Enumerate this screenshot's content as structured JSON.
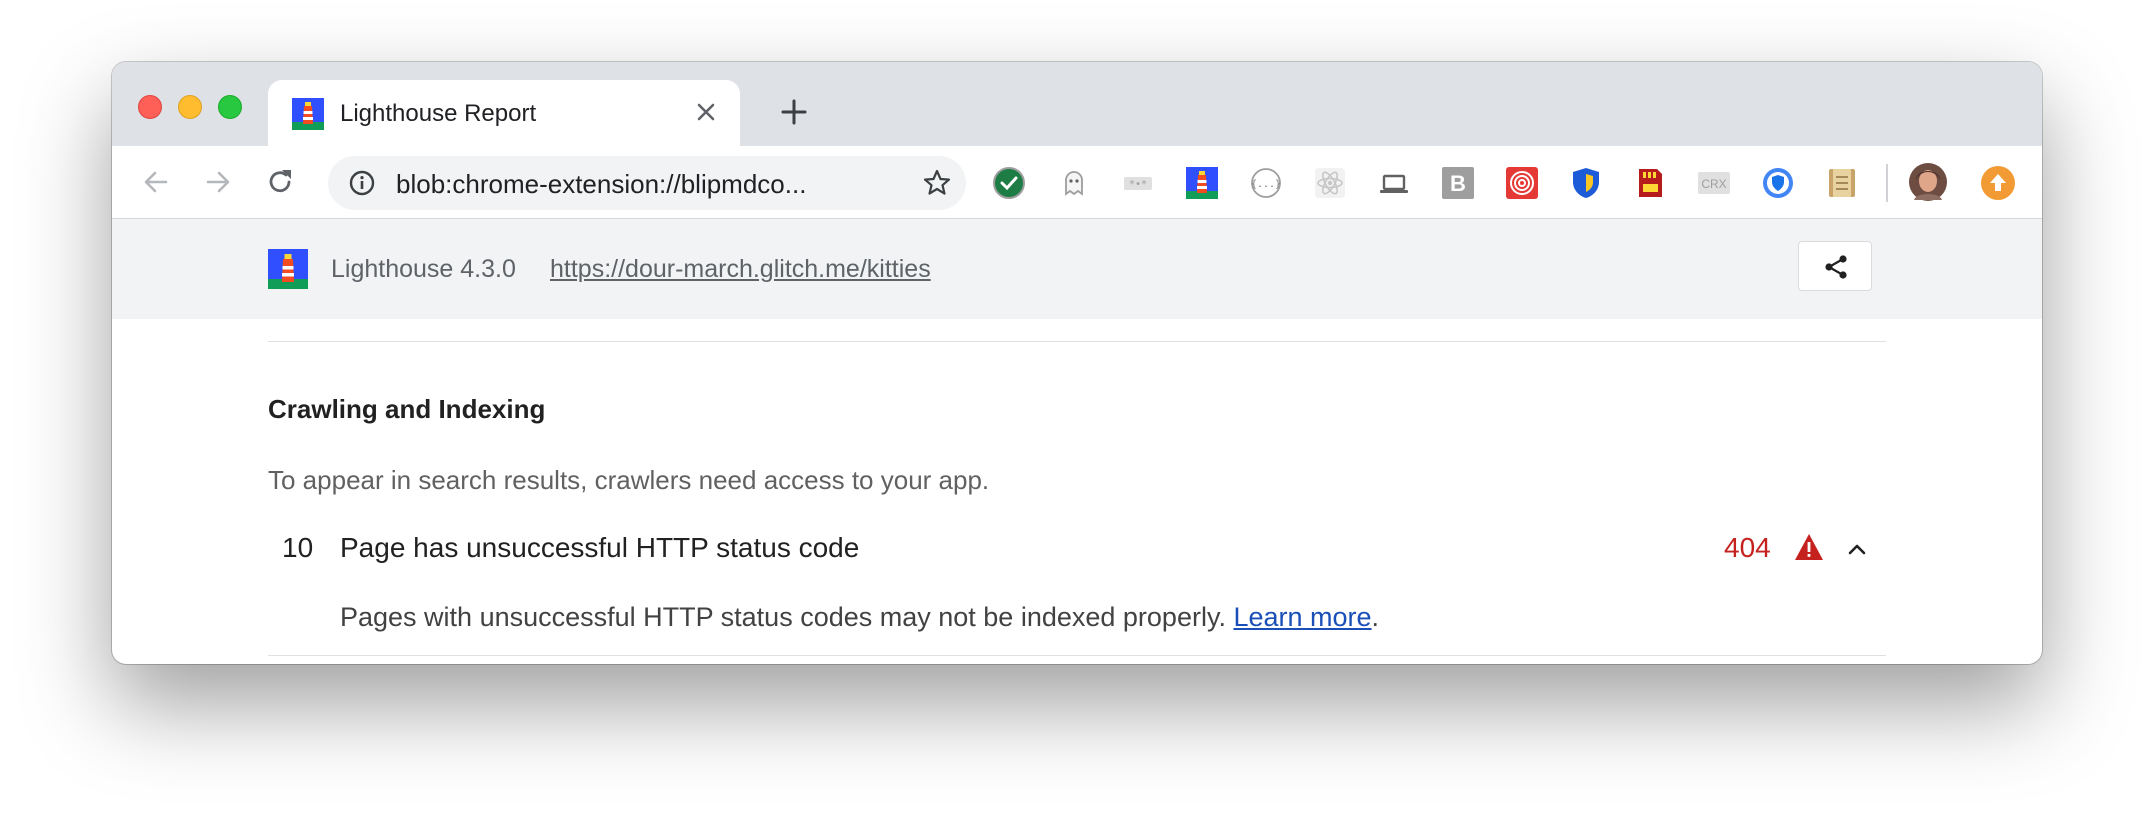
{
  "browser": {
    "tab": {
      "title": "Lighthouse Report"
    },
    "omnibox": {
      "url": "blob:chrome-extension://blipmdco..."
    },
    "extensions": [
      "green-check-extension-icon",
      "ghost-extension-icon",
      "password-dots-extension-icon",
      "lighthouse-extension-icon",
      "json-braces-extension-icon",
      "react-extension-icon",
      "laptop-extension-icon",
      "b-letter-extension-icon",
      "red-spiral-extension-icon",
      "blue-shield-extension-icon",
      "sd-card-extension-icon",
      "crx-extension-icon",
      "blue-shield-circle-extension-icon",
      "notebook-extension-icon"
    ],
    "crx_label": "CRX",
    "b_label": "B"
  },
  "lighthouse": {
    "version": "Lighthouse 4.3.0",
    "url": "https://dour-march.glitch.me/kitties"
  },
  "section": {
    "title": "Crawling and Indexing",
    "description": "To appear in search results, crawlers need access to your app."
  },
  "audit": {
    "index": "10",
    "title": "Page has unsuccessful HTTP status code",
    "value": "404",
    "description": "Pages with unsuccessful HTTP status codes may not be indexed properly.",
    "learn_more": "Learn more",
    "period": "."
  },
  "colors": {
    "error_red": "#c5221f",
    "link_blue": "#1a4fb8",
    "tabstrip_gray": "#dee1e6",
    "topbar_gray": "#f1f3f4"
  }
}
